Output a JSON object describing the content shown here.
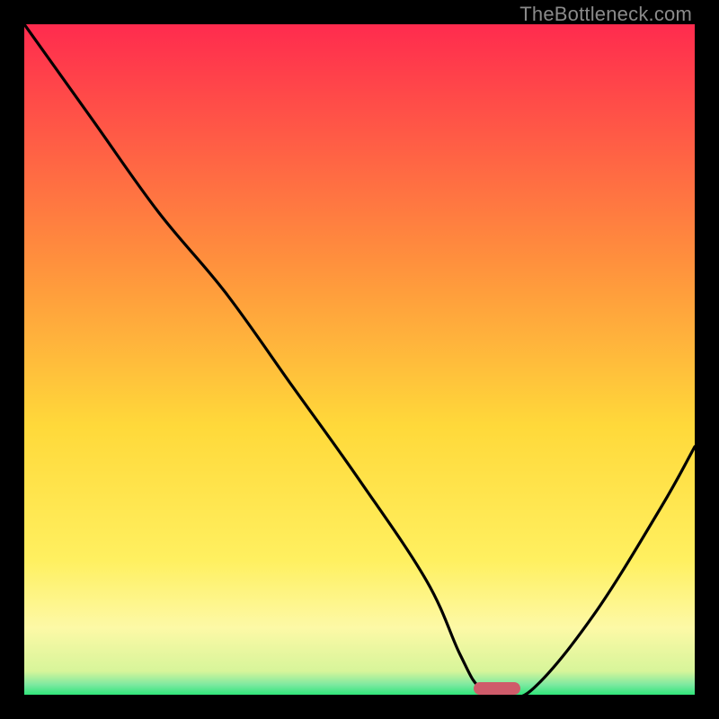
{
  "watermark": "TheBottleneck.com",
  "colors": {
    "top": "#ff2b4e",
    "mid_upper": "#ffb23a",
    "mid": "#ffe634",
    "pale": "#fdf9a6",
    "green": "#2fe57a",
    "curve": "#000000",
    "marker": "#cf5b6a",
    "frame": "#000000"
  },
  "chart_data": {
    "type": "line",
    "title": "",
    "xlabel": "",
    "ylabel": "",
    "xlim": [
      0,
      100
    ],
    "ylim": [
      0,
      100
    ],
    "series": [
      {
        "name": "bottleneck-curve",
        "x": [
          0,
          10,
          20,
          30,
          40,
          50,
          60,
          65,
          68,
          72,
          76,
          85,
          95,
          100
        ],
        "y": [
          100,
          86,
          72,
          60,
          46,
          32,
          17,
          6,
          1,
          0,
          1,
          12,
          28,
          37
        ]
      }
    ],
    "marker": {
      "x_start": 67,
      "x_end": 74,
      "y": 0
    },
    "gradient_stops": [
      {
        "pos": 0.0,
        "color": "#ff2b4e"
      },
      {
        "pos": 0.35,
        "color": "#ff8f3d"
      },
      {
        "pos": 0.6,
        "color": "#ffd93a"
      },
      {
        "pos": 0.8,
        "color": "#fff060"
      },
      {
        "pos": 0.9,
        "color": "#fdf9a6"
      },
      {
        "pos": 0.965,
        "color": "#d7f59a"
      },
      {
        "pos": 0.985,
        "color": "#7de9a0"
      },
      {
        "pos": 1.0,
        "color": "#2fe57a"
      }
    ]
  }
}
